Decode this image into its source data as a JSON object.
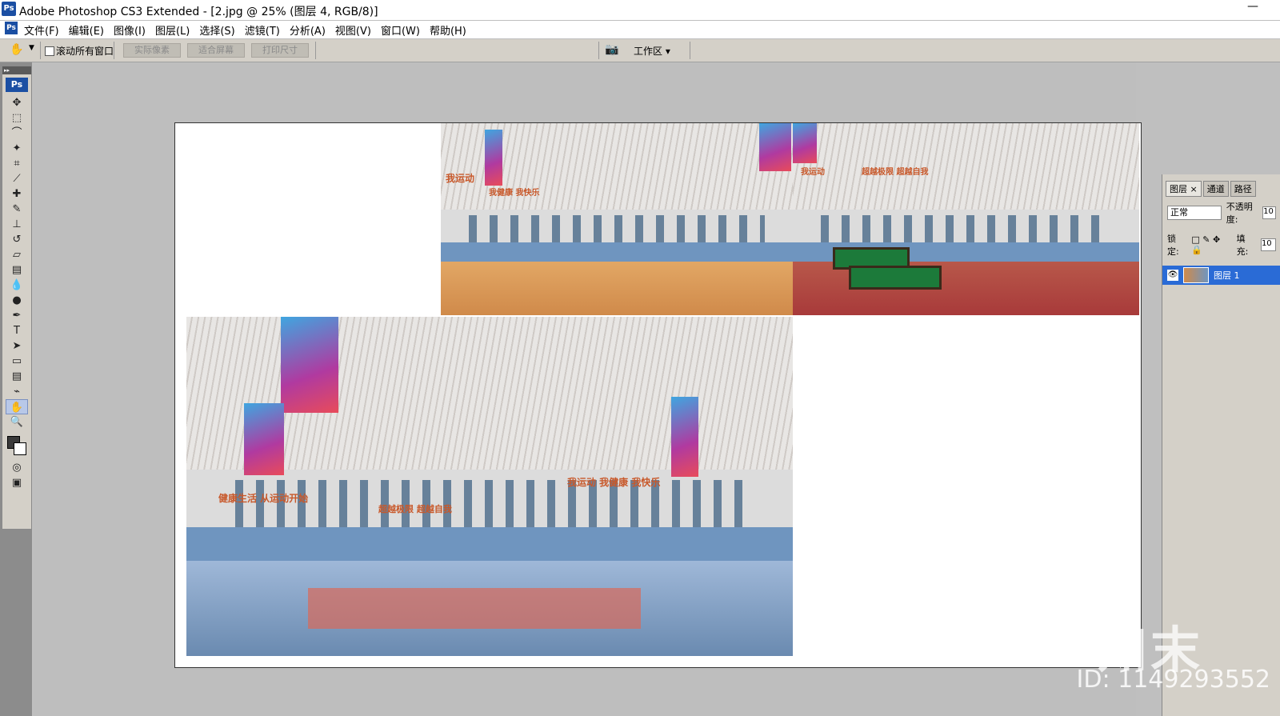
{
  "window": {
    "title": "Adobe Photoshop CS3 Extended - [2.jpg @ 25% (图层 4, RGB/8)]",
    "minimize_glyph": "—",
    "app_icon_label": "Ps"
  },
  "menubar": {
    "icon_label": "Ps",
    "items": [
      "文件(F)",
      "编辑(E)",
      "图像(I)",
      "图层(L)",
      "选择(S)",
      "滤镜(T)",
      "分析(A)",
      "视图(V)",
      "窗口(W)",
      "帮助(H)"
    ]
  },
  "options_bar": {
    "scroll_all_label": "滚动所有窗口",
    "actual_pixels_label": "实际像素",
    "fit_screen_label": "适合屏幕",
    "print_size_label": "打印尺寸",
    "workspace_label": "工作区 ▾"
  },
  "toolbox": {
    "logo": "Ps",
    "tools": [
      {
        "name": "move-tool",
        "glyph": "✥"
      },
      {
        "name": "marquee-tool",
        "glyph": "⬚"
      },
      {
        "name": "lasso-tool",
        "glyph": "⌒"
      },
      {
        "name": "magic-wand-tool",
        "glyph": "✦"
      },
      {
        "name": "crop-tool",
        "glyph": "⌗"
      },
      {
        "name": "slice-tool",
        "glyph": "⟋"
      },
      {
        "name": "healing-brush-tool",
        "glyph": "✚"
      },
      {
        "name": "brush-tool",
        "glyph": "✎"
      },
      {
        "name": "clone-stamp-tool",
        "glyph": "⊥"
      },
      {
        "name": "history-brush-tool",
        "glyph": "↺"
      },
      {
        "name": "eraser-tool",
        "glyph": "▱"
      },
      {
        "name": "gradient-tool",
        "glyph": "▤"
      },
      {
        "name": "blur-tool",
        "glyph": "💧"
      },
      {
        "name": "dodge-tool",
        "glyph": "●"
      },
      {
        "name": "pen-tool",
        "glyph": "✒"
      },
      {
        "name": "type-tool",
        "glyph": "T"
      },
      {
        "name": "path-selection-tool",
        "glyph": "➤"
      },
      {
        "name": "shape-tool",
        "glyph": "▭"
      },
      {
        "name": "notes-tool",
        "glyph": "▤"
      },
      {
        "name": "eyedropper-tool",
        "glyph": "⌁"
      },
      {
        "name": "hand-tool",
        "glyph": "✋"
      },
      {
        "name": "zoom-tool",
        "glyph": "🔍"
      }
    ],
    "active_tool": "hand-tool"
  },
  "canvas": {
    "slogans": {
      "photo1_left": "我运动",
      "photo1_mid": "我健康 我快乐",
      "photo2_a": "我运动",
      "photo2_b": "超越极限 超越自我",
      "photo3_left": "健康生活 从运动开始",
      "photo3_mid": "超越极限 超越自我",
      "photo3_right": "我运动  我健康  我快乐"
    }
  },
  "layers_panel": {
    "tabs": [
      "图层 ×",
      "通道",
      "路径"
    ],
    "blend_mode": "正常",
    "opacity_label": "不透明度:",
    "opacity_value": "10",
    "lock_label": "锁定:",
    "fill_label": "填充:",
    "fill_value": "10",
    "layer_name": "图层 1",
    "eye_glyph": "👁"
  },
  "watermark": {
    "logo_text": "知末",
    "id_text": "ID: 1149293552"
  }
}
